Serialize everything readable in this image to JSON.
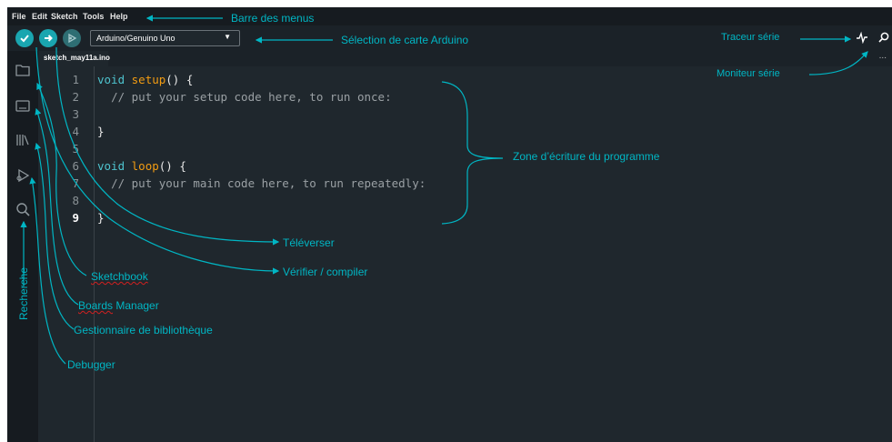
{
  "menubar": {
    "items": [
      "File",
      "Edit",
      "Sketch",
      "Tools",
      "Help"
    ]
  },
  "toolbar": {
    "board": "Arduino/Genuino Uno",
    "verify_icon": "check-icon",
    "upload_icon": "arrow-right-icon",
    "debug_icon": "debug-icon",
    "serial_plotter_icon": "waveform-icon",
    "serial_monitor_icon": "magnifier-icon"
  },
  "tabs": {
    "file": "sketch_may11a.ino",
    "more": "..."
  },
  "sidebar": {
    "icons": [
      "folder-icon",
      "boards-icon",
      "library-icon",
      "debug-icon",
      "search-icon"
    ]
  },
  "editor": {
    "lines": [
      {
        "num": "1",
        "parts": [
          {
            "t": "void",
            "c": "kw"
          },
          {
            "t": " "
          },
          {
            "t": "setup",
            "c": "fn"
          },
          {
            "t": "() {"
          }
        ]
      },
      {
        "num": "2",
        "parts": [
          {
            "t": "  "
          },
          {
            "t": "// put your setup code here, to run once:",
            "c": "cm"
          }
        ]
      },
      {
        "num": "3",
        "parts": []
      },
      {
        "num": "4",
        "parts": [
          {
            "t": "}"
          }
        ]
      },
      {
        "num": "5",
        "parts": []
      },
      {
        "num": "6",
        "parts": [
          {
            "t": "void",
            "c": "kw"
          },
          {
            "t": " "
          },
          {
            "t": "loop",
            "c": "fn"
          },
          {
            "t": "() {"
          }
        ]
      },
      {
        "num": "7",
        "parts": [
          {
            "t": "  "
          },
          {
            "t": "// put your main code here, to run repeatedly:",
            "c": "cm"
          }
        ]
      },
      {
        "num": "8",
        "parts": []
      },
      {
        "num": "9",
        "parts": [
          {
            "t": "}"
          }
        ],
        "active": true
      }
    ]
  },
  "annotations": {
    "menu_bar": "Barre des menus",
    "board_select": "Sélection de carte Arduino",
    "serial_plotter": "Traceur série",
    "serial_monitor": "Moniteur série",
    "code_area": "Zone d’écriture du programme",
    "upload": "Téléverser",
    "verify": "Vérifier / compiler",
    "sketchbook": "Sketchbook",
    "boards_manager_a": "Boards",
    "boards_manager_b": " Manager",
    "library_manager": "Gestionnaire de bibliothèque",
    "debugger": "Debugger",
    "search": "Recherche"
  },
  "colors": {
    "accent": "#00b6c4",
    "verify_button": "#1aa6b0",
    "debug_button": "#2e6e73",
    "editor_bg": "#1f272d",
    "keyword": "#4ec3ce",
    "function": "#f39c12"
  }
}
